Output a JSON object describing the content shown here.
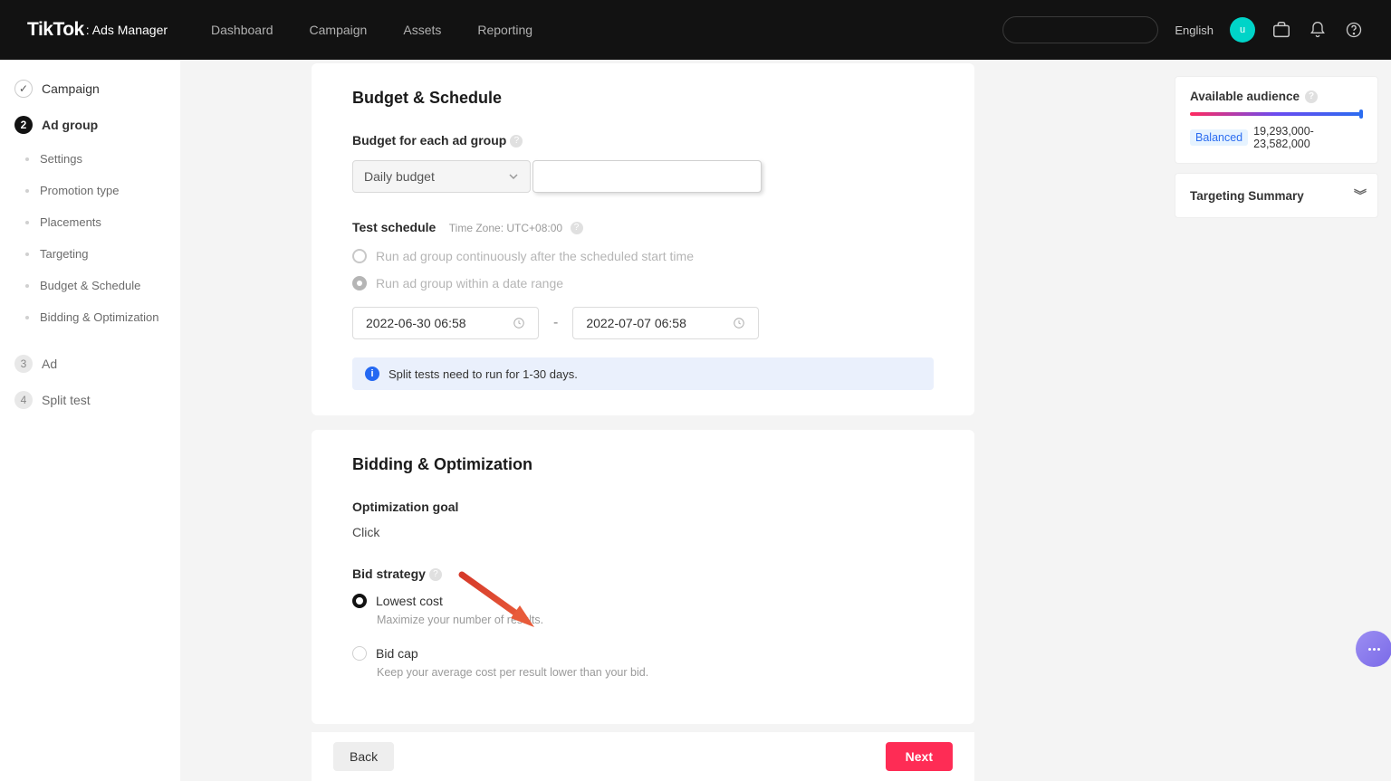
{
  "header": {
    "logo_main": "TikTok",
    "logo_sub": ": Ads Manager",
    "nav": [
      "Dashboard",
      "Campaign",
      "Assets",
      "Reporting"
    ],
    "language": "English",
    "avatar_initial": "u"
  },
  "sidebar": {
    "steps": [
      {
        "num": "✓",
        "label": "Campaign",
        "state": "check"
      },
      {
        "num": "2",
        "label": "Ad group",
        "state": "active"
      },
      {
        "num": "3",
        "label": "Ad",
        "state": "inactive"
      },
      {
        "num": "4",
        "label": "Split test",
        "state": "inactive"
      }
    ],
    "substeps": [
      "Settings",
      "Promotion type",
      "Placements",
      "Targeting",
      "Budget & Schedule",
      "Bidding & Optimization"
    ]
  },
  "budget_schedule": {
    "title": "Budget & Schedule",
    "budget_label": "Budget for each ad group",
    "budget_type": "Daily budget",
    "test_schedule_label": "Test schedule",
    "time_zone": "Time Zone: UTC+08:00",
    "schedule_options": [
      "Run ad group continuously after the scheduled start time",
      "Run ad group within a date range"
    ],
    "start_date": "2022-06-30 06:58",
    "end_date": "2022-07-07 06:58",
    "info_text": "Split tests need to run for 1-30 days."
  },
  "bidding": {
    "title": "Bidding & Optimization",
    "goal_label": "Optimization goal",
    "goal_value": "Click",
    "strategy_label": "Bid strategy",
    "options": [
      {
        "label": "Lowest cost",
        "desc": "Maximize your number of results.",
        "selected": true
      },
      {
        "label": "Bid cap",
        "desc": "Keep your average cost per result lower than your bid.",
        "selected": false
      }
    ]
  },
  "footer": {
    "back": "Back",
    "next": "Next"
  },
  "right": {
    "audience_label": "Available audience",
    "balanced": "Balanced",
    "range": "19,293,000-23,582,000",
    "targeting_summary": "Targeting Summary"
  }
}
